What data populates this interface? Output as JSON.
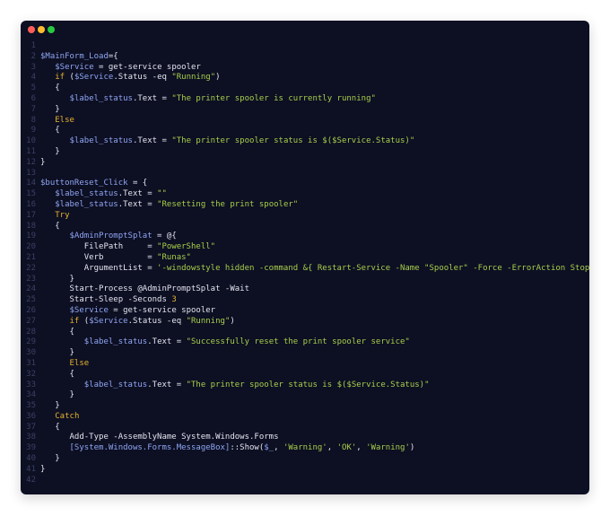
{
  "window": {
    "controls": [
      "close",
      "minimize",
      "maximize"
    ],
    "colors": {
      "background": "#0d0f23",
      "variable": "#8ea6f2",
      "keyword": "#e5b32f",
      "string": "#a8cf4a",
      "plain": "#e3e5ef",
      "line_number": "#3b4163"
    }
  },
  "code": {
    "lines": [
      [],
      [
        [
          "var",
          "$MainForm_Load"
        ],
        [
          "plain",
          "={"
        ]
      ],
      [
        [
          "plain",
          "   "
        ],
        [
          "var",
          "$Service"
        ],
        [
          "plain",
          " = get-service spooler"
        ]
      ],
      [
        [
          "plain",
          "   "
        ],
        [
          "kw",
          "if"
        ],
        [
          "plain",
          " ("
        ],
        [
          "var",
          "$Service"
        ],
        [
          "plain",
          ".Status -eq "
        ],
        [
          "str",
          "\"Running\""
        ],
        [
          "plain",
          ")"
        ]
      ],
      [
        [
          "plain",
          "   {"
        ]
      ],
      [
        [
          "plain",
          "      "
        ],
        [
          "var",
          "$label_status"
        ],
        [
          "plain",
          ".Text = "
        ],
        [
          "str",
          "\"The printer spooler is currently running\""
        ]
      ],
      [
        [
          "plain",
          "   }"
        ]
      ],
      [
        [
          "plain",
          "   "
        ],
        [
          "kw",
          "Else"
        ]
      ],
      [
        [
          "plain",
          "   {"
        ]
      ],
      [
        [
          "plain",
          "      "
        ],
        [
          "var",
          "$label_status"
        ],
        [
          "plain",
          ".Text = "
        ],
        [
          "str",
          "\"The printer spooler status is $($Service.Status)\""
        ]
      ],
      [
        [
          "plain",
          "   }"
        ]
      ],
      [
        [
          "plain",
          "}"
        ]
      ],
      [],
      [
        [
          "var",
          "$buttonReset_Click"
        ],
        [
          "plain",
          " = {"
        ]
      ],
      [
        [
          "plain",
          "   "
        ],
        [
          "var",
          "$label_status"
        ],
        [
          "plain",
          ".Text = "
        ],
        [
          "str",
          "\"\""
        ]
      ],
      [
        [
          "plain",
          "   "
        ],
        [
          "var",
          "$label_status"
        ],
        [
          "plain",
          ".Text = "
        ],
        [
          "str",
          "\"Resetting the print spooler\""
        ]
      ],
      [
        [
          "plain",
          "   "
        ],
        [
          "kw",
          "Try"
        ]
      ],
      [
        [
          "plain",
          "   {"
        ]
      ],
      [
        [
          "plain",
          "      "
        ],
        [
          "var",
          "$AdminPromptSplat"
        ],
        [
          "plain",
          " = @{"
        ]
      ],
      [
        [
          "plain",
          "         FilePath     = "
        ],
        [
          "str",
          "\"PowerShell\""
        ]
      ],
      [
        [
          "plain",
          "         Verb         = "
        ],
        [
          "str",
          "\"Runas\""
        ]
      ],
      [
        [
          "plain",
          "         ArgumentList = "
        ],
        [
          "str",
          "'-windowstyle hidden -command &{ Restart-Service -Name \"Spooler\" -Force -ErrorAction Stop }'"
        ]
      ],
      [
        [
          "plain",
          "      }"
        ]
      ],
      [
        [
          "plain",
          "      Start-Process @AdminPromptSplat -Wait"
        ]
      ],
      [
        [
          "plain",
          "      Start-Sleep -Seconds "
        ],
        [
          "num",
          "3"
        ]
      ],
      [
        [
          "plain",
          "      "
        ],
        [
          "var",
          "$Service"
        ],
        [
          "plain",
          " = get-service spooler"
        ]
      ],
      [
        [
          "plain",
          "      "
        ],
        [
          "kw",
          "if"
        ],
        [
          "plain",
          " ("
        ],
        [
          "var",
          "$Service"
        ],
        [
          "plain",
          ".Status -eq "
        ],
        [
          "str",
          "\"Running\""
        ],
        [
          "plain",
          ")"
        ]
      ],
      [
        [
          "plain",
          "      {"
        ]
      ],
      [
        [
          "plain",
          "         "
        ],
        [
          "var",
          "$label_status"
        ],
        [
          "plain",
          ".Text = "
        ],
        [
          "str",
          "\"Successfully reset the print spooler service\""
        ]
      ],
      [
        [
          "plain",
          "      }"
        ]
      ],
      [
        [
          "plain",
          "      "
        ],
        [
          "kw",
          "Else"
        ]
      ],
      [
        [
          "plain",
          "      {"
        ]
      ],
      [
        [
          "plain",
          "         "
        ],
        [
          "var",
          "$label_status"
        ],
        [
          "plain",
          ".Text = "
        ],
        [
          "str",
          "\"The printer spooler status is $($Service.Status)\""
        ]
      ],
      [
        [
          "plain",
          "      }"
        ]
      ],
      [
        [
          "plain",
          "   }"
        ]
      ],
      [
        [
          "plain",
          "   "
        ],
        [
          "kw",
          "Catch"
        ]
      ],
      [
        [
          "plain",
          "   {"
        ]
      ],
      [
        [
          "plain",
          "      Add-Type -AssemblyName System.Windows.Forms"
        ]
      ],
      [
        [
          "plain",
          "      "
        ],
        [
          "type",
          "[System.Windows.Forms.MessageBox]"
        ],
        [
          "plain",
          "::Show("
        ],
        [
          "var",
          "$_"
        ],
        [
          "plain",
          ", "
        ],
        [
          "str",
          "'Warning'"
        ],
        [
          "plain",
          ", "
        ],
        [
          "str",
          "'OK'"
        ],
        [
          "plain",
          ", "
        ],
        [
          "str",
          "'Warning'"
        ],
        [
          "plain",
          ")"
        ]
      ],
      [
        [
          "plain",
          "   }"
        ]
      ],
      [
        [
          "plain",
          "}"
        ]
      ],
      []
    ]
  }
}
